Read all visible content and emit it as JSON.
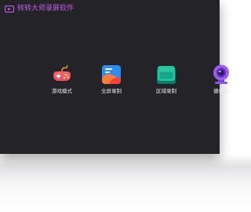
{
  "app": {
    "title": "转转大师录屏软件",
    "accent_color": "#c05be6",
    "background_color": "#242428"
  },
  "recording_modes": [
    {
      "label": "游戏模式",
      "icon": "gamepad-icon"
    },
    {
      "label": "全屏录制",
      "icon": "fullscreen-icon"
    },
    {
      "label": "区域录制",
      "icon": "region-icon"
    },
    {
      "label": "摄像头",
      "icon": "camera-icon"
    }
  ]
}
